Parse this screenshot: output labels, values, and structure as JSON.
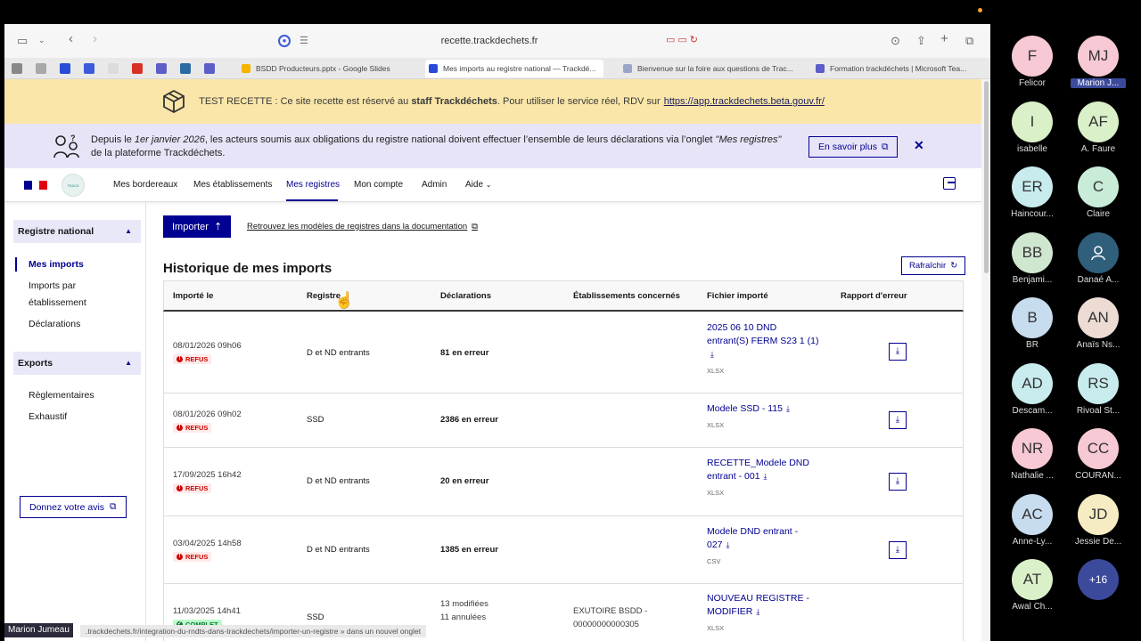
{
  "browser": {
    "url": "recette.trackdechets.fr",
    "tabs": [
      {
        "title": "BSDD Producteurs.pptx - Google Slides",
        "fav": "#f4b400"
      },
      {
        "title": "Mes imports au registre national — Trackdé...",
        "fav": "#2a4bd7",
        "active": true
      },
      {
        "title": "Bienvenue sur la foire aux questions de Trac...",
        "fav": "#9aa6c8"
      },
      {
        "title": "Formation trackdéchets | Microsoft Tea...",
        "fav": "#5b5fc7"
      }
    ],
    "pinned_colors": [
      "#888888",
      "#a8a8a8",
      "#2a4bd7",
      "#3b5bdb",
      "#dcdcdc",
      "#d93025",
      "#5b5fc7",
      "#2d6aa3",
      "#5b5fc7"
    ]
  },
  "test_banner": {
    "prefix": "TEST RECETTE : Ce site recette est réservé au ",
    "bold": "staff Trackdéchets",
    "suffix": ". Pour utiliser le service réel, RDV sur",
    "link": "https://app.trackdechets.beta.gouv.fr/"
  },
  "info_banner": {
    "p1": "Depuis le ",
    "date": "1er janvier 2026",
    "p2": ", les acteurs soumis aux obligations du registre national doivent effectuer l’ensemble de leurs déclarations via l’onglet ",
    "tab": "\"Mes registres\"",
    "p3": "de la plateforme Trackdéchets.",
    "button": "En savoir plus",
    "close": "✕"
  },
  "nav": {
    "items": [
      "Mes bordereaux",
      "Mes établissements",
      "Mes registres",
      "Mon compte",
      "Admin",
      "Aide"
    ],
    "active": "Mes registres"
  },
  "sidebar": {
    "group1": "Registre national",
    "group1_items": [
      "Mes imports",
      "Imports par",
      "établissement",
      "Déclarations"
    ],
    "group2": "Exports",
    "group2_items": [
      "Règlementaires",
      "Exhaustif"
    ],
    "feedback": "Donnez votre avis"
  },
  "main": {
    "import_button": "Importer",
    "doc_link": "Retrouvez les modèles de registres dans la documentation",
    "title": "Historique de mes imports",
    "refresh": "Rafraîchir",
    "columns": [
      "Importé le",
      "Registre",
      "Déclarations",
      "Établissements concernés",
      "Fichier importé",
      "Rapport d'erreur"
    ],
    "rows": [
      {
        "date": "08/01/2026 09h06",
        "status": "REFUS",
        "registre": "D et ND entrants",
        "decl": "81 en erreur",
        "etab": "",
        "file_l1": "2025 06 10 DND",
        "file_l2": "entrant(S) FERM S23 1 (1)",
        "file_l3": "",
        "type": "XLSX"
      },
      {
        "date": "08/01/2026 09h02",
        "status": "REFUS",
        "registre": "SSD",
        "decl": "2386 en erreur",
        "etab": "",
        "file_l1": "Modele SSD - 115",
        "file_l2": "",
        "file_l3": "",
        "type": "XLSX"
      },
      {
        "date": "17/09/2025 16h42",
        "status": "REFUS",
        "registre": "D et ND entrants",
        "decl": "20 en erreur",
        "etab": "",
        "file_l1": "RECETTE_Modele DND",
        "file_l2": "entrant - 001",
        "file_l3": "",
        "type": "XLSX"
      },
      {
        "date": "03/04/2025 14h58",
        "status": "REFUS",
        "registre": "D et ND entrants",
        "decl": "1385 en erreur",
        "etab": "",
        "file_l1": "Modele DND entrant -",
        "file_l2": "027",
        "file_l3": "",
        "type": "CSV"
      },
      {
        "date": "11/03/2025 14h41",
        "status": "COMPLET",
        "registre": "SSD",
        "decl_l1": "13 modifiées",
        "decl_l2": "11 annulées",
        "etab_l1": "EXUTOIRE BSDD -",
        "etab_l2": "00000000000305",
        "file_l1": "NOUVEAU REGISTRE -",
        "file_l2": "MODIFIER",
        "type": "XLSX"
      }
    ]
  },
  "overlay": {
    "speaker": "Marion Jumeau",
    "status_url": ".trackdechets.fr/integration-du-rndts-dans-trackdechets/importer-un-registre » dans un nouvel onglet"
  },
  "participants": [
    {
      "initials": "F",
      "name": "Felicor",
      "color": "#f7c9d4"
    },
    {
      "initials": "MJ",
      "name": "Marion J...",
      "color": "#f7c9d4",
      "highlight": true
    },
    {
      "initials": "I",
      "name": "isabelle",
      "color": "#d9f0c8"
    },
    {
      "initials": "AF",
      "name": "A. Faure",
      "color": "#d9f0c8"
    },
    {
      "initials": "ER",
      "name": "Haincour...",
      "color": "#c8ecee"
    },
    {
      "initials": "C",
      "name": "Claire",
      "color": "#c8ecd8"
    },
    {
      "initials": "BB",
      "name": "Benjami...",
      "color": "#cfe7cf"
    },
    {
      "initials": "",
      "name": "Danaé A...",
      "color": "#2f5f7a",
      "icon": true
    },
    {
      "initials": "B",
      "name": "BR",
      "color": "#c8dcef"
    },
    {
      "initials": "AN",
      "name": "Anaïs Ns...",
      "color": "#ecdcd4"
    },
    {
      "initials": "AD",
      "name": "Descam...",
      "color": "#c8ecee"
    },
    {
      "initials": "RS",
      "name": "Rivoal St...",
      "color": "#c8ecee"
    },
    {
      "initials": "NR",
      "name": "Nathalie ...",
      "color": "#f7c9d4"
    },
    {
      "initials": "CC",
      "name": "COURAN...",
      "color": "#f7c9d4"
    },
    {
      "initials": "AC",
      "name": "Anne-Ly...",
      "color": "#c8dcef"
    },
    {
      "initials": "JD",
      "name": "Jessie De...",
      "color": "#f5ecc4"
    },
    {
      "initials": "AT",
      "name": "Awal Ch...",
      "color": "#d9f0c8"
    },
    {
      "initials": "+16",
      "name": "",
      "color": "#3c4a9c",
      "more": true
    }
  ]
}
